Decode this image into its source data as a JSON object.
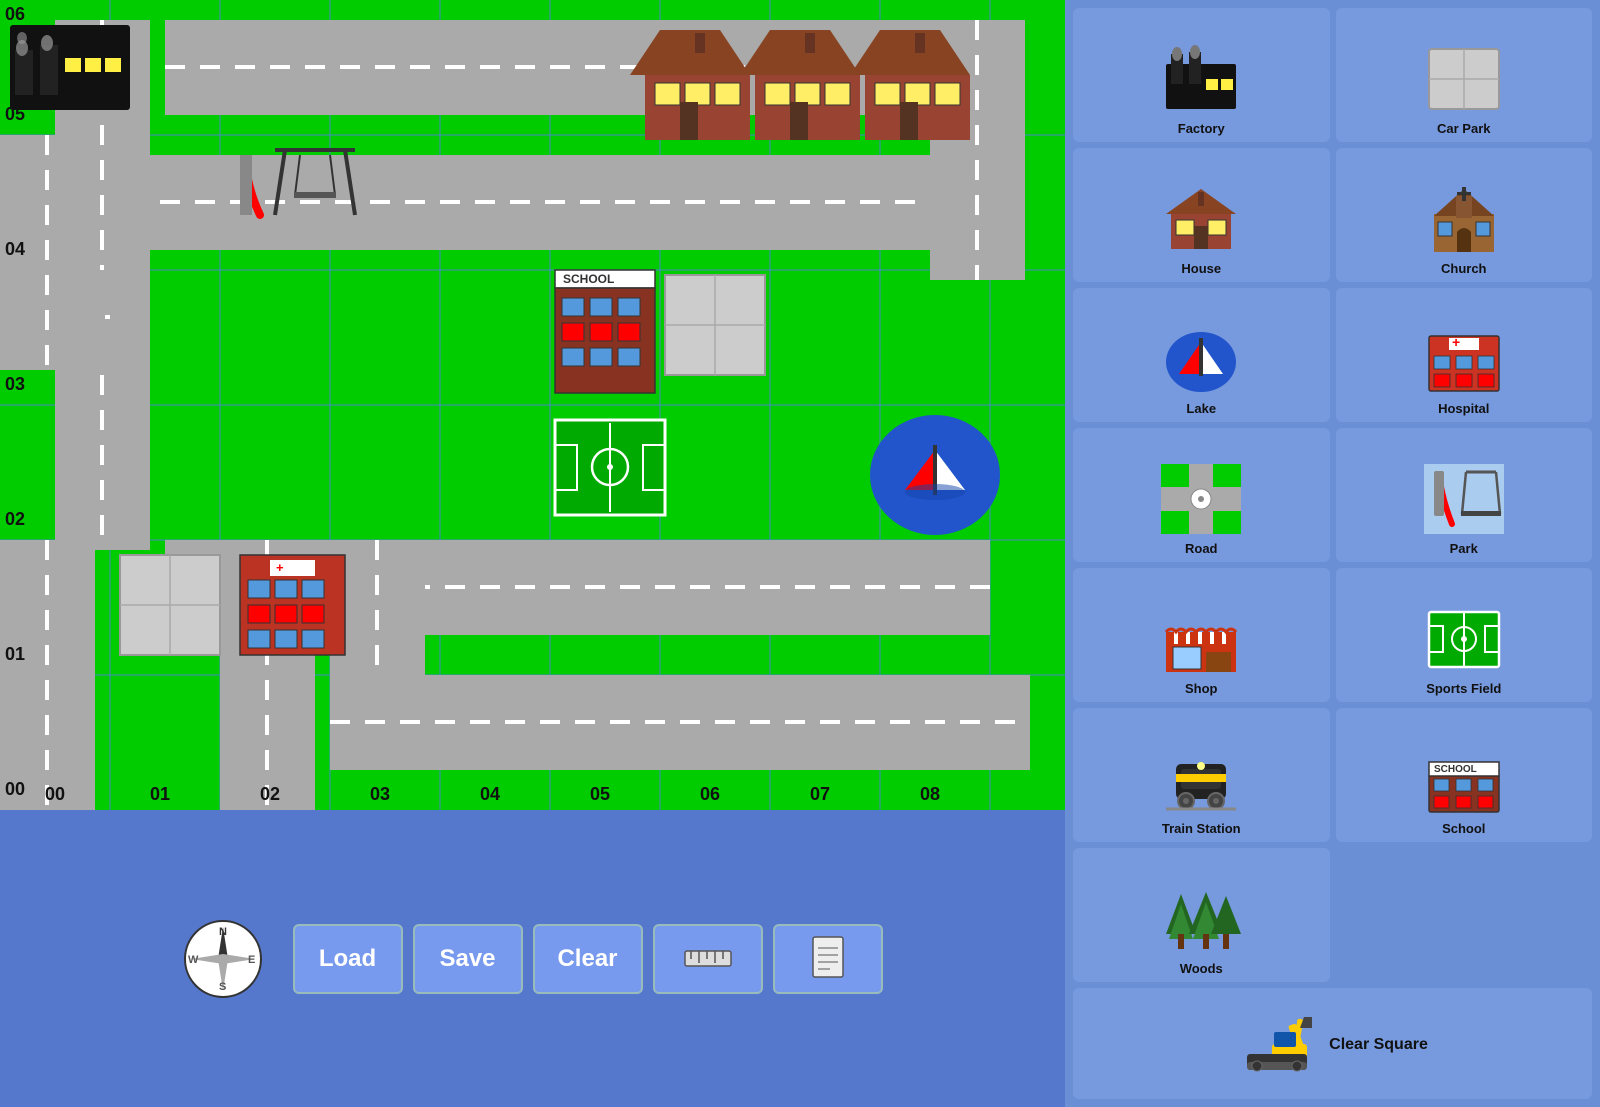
{
  "sidebar": {
    "tiles": [
      {
        "id": "factory",
        "label": "Factory"
      },
      {
        "id": "car-park",
        "label": "Car Park"
      },
      {
        "id": "house",
        "label": "House"
      },
      {
        "id": "church",
        "label": "Church"
      },
      {
        "id": "lake",
        "label": "Lake"
      },
      {
        "id": "hospital",
        "label": "Hospital"
      },
      {
        "id": "road",
        "label": "Road"
      },
      {
        "id": "park",
        "label": "Park"
      },
      {
        "id": "shop",
        "label": "Shop"
      },
      {
        "id": "sports-field",
        "label": "Sports Field"
      },
      {
        "id": "train-station",
        "label": "Train Station"
      },
      {
        "id": "school",
        "label": "School"
      },
      {
        "id": "woods",
        "label": "Woods"
      },
      {
        "id": "clear-square",
        "label": "Clear Square"
      }
    ]
  },
  "bottom_buttons": [
    {
      "id": "load",
      "label": "Load"
    },
    {
      "id": "save",
      "label": "Save"
    },
    {
      "id": "clear",
      "label": "Clear"
    },
    {
      "id": "ruler",
      "label": ""
    },
    {
      "id": "document",
      "label": ""
    }
  ],
  "grid": {
    "cols": [
      "00",
      "01",
      "02",
      "03",
      "04",
      "05",
      "06",
      "07",
      "08"
    ],
    "rows": [
      "00",
      "01",
      "02",
      "03",
      "04",
      "05",
      "06"
    ]
  }
}
